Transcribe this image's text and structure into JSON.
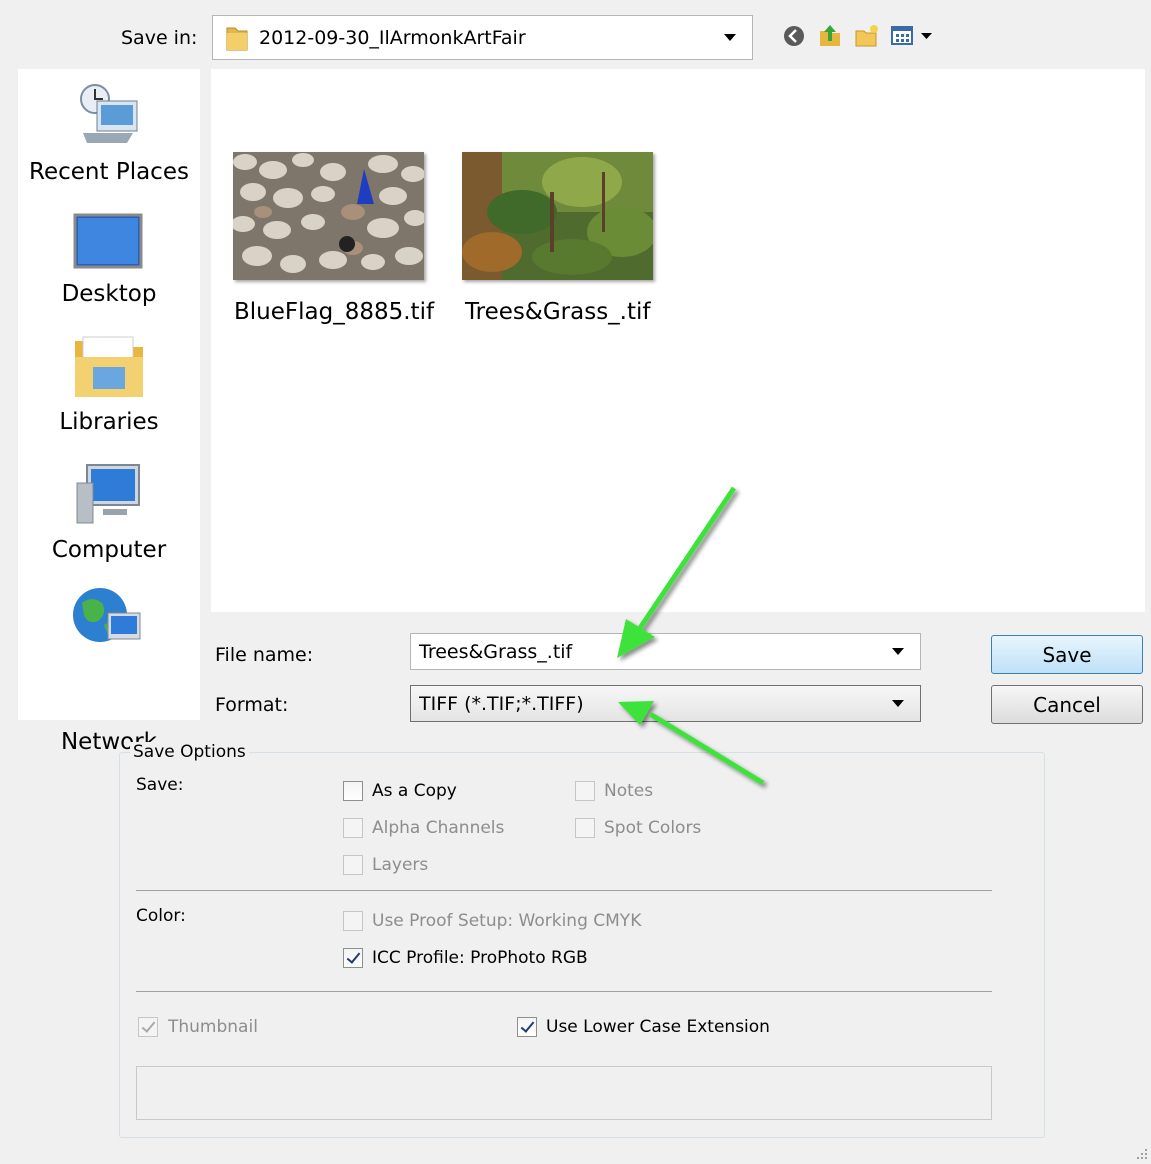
{
  "toolbar": {
    "save_in_label": "Save in:",
    "current_folder": "2012-09-30_IlArmonkArtFair",
    "icons": [
      "back-icon",
      "up-folder-icon",
      "new-folder-icon",
      "view-menu-icon"
    ]
  },
  "places": [
    {
      "label": "Recent Places",
      "icon": "recent-places-icon"
    },
    {
      "label": "Desktop",
      "icon": "desktop-icon"
    },
    {
      "label": "Libraries",
      "icon": "libraries-icon"
    },
    {
      "label": "Computer",
      "icon": "computer-icon"
    },
    {
      "label": "Network",
      "icon": "network-icon"
    }
  ],
  "files": [
    {
      "name": "BlueFlag_8885.tif"
    },
    {
      "name": "Trees&Grass_.tif"
    }
  ],
  "form": {
    "file_name_label": "File name:",
    "file_name_value": "Trees&Grass_.tif",
    "format_label": "Format:",
    "format_value": "TIFF (*.TIF;*.TIFF)",
    "save_button": "Save",
    "cancel_button": "Cancel"
  },
  "save_options": {
    "legend": "Save Options",
    "save_label": "Save:",
    "as_a_copy": "As a Copy",
    "notes": "Notes",
    "alpha_channels": "Alpha Channels",
    "spot_colors": "Spot Colors",
    "layers": "Layers",
    "color_label": "Color:",
    "use_proof_setup": "Use Proof Setup:  Working CMYK",
    "icc_profile": "ICC Profile:  ProPhoto RGB",
    "thumbnail": "Thumbnail",
    "use_lower_case_extension": "Use Lower Case Extension"
  },
  "colors": {
    "annotation_arrow": "#3ee23a",
    "primary_button": "#bfe1f8"
  }
}
